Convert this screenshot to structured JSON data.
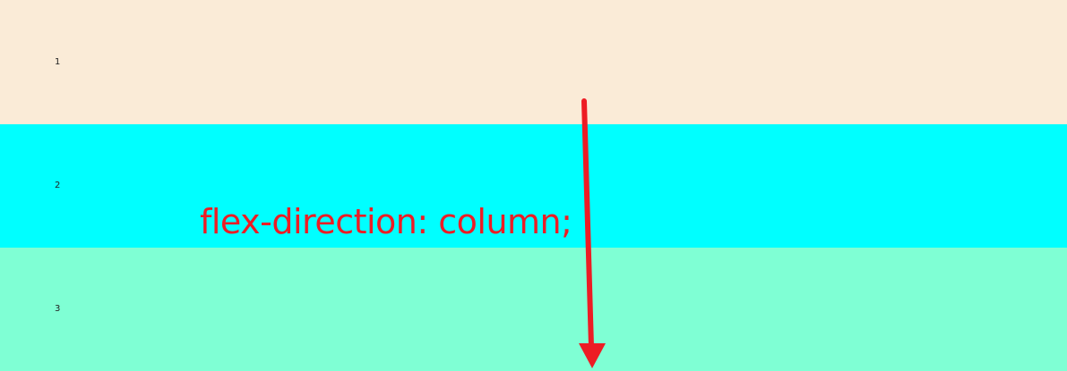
{
  "items": [
    {
      "label": "1",
      "color": "#faebd7"
    },
    {
      "label": "2",
      "color": "#00ffff"
    },
    {
      "label": "3",
      "color": "#7fffd4"
    }
  ],
  "annotation": {
    "text": "flex-direction: column;",
    "color": "#ed1c24",
    "arrow_direction": "down"
  }
}
